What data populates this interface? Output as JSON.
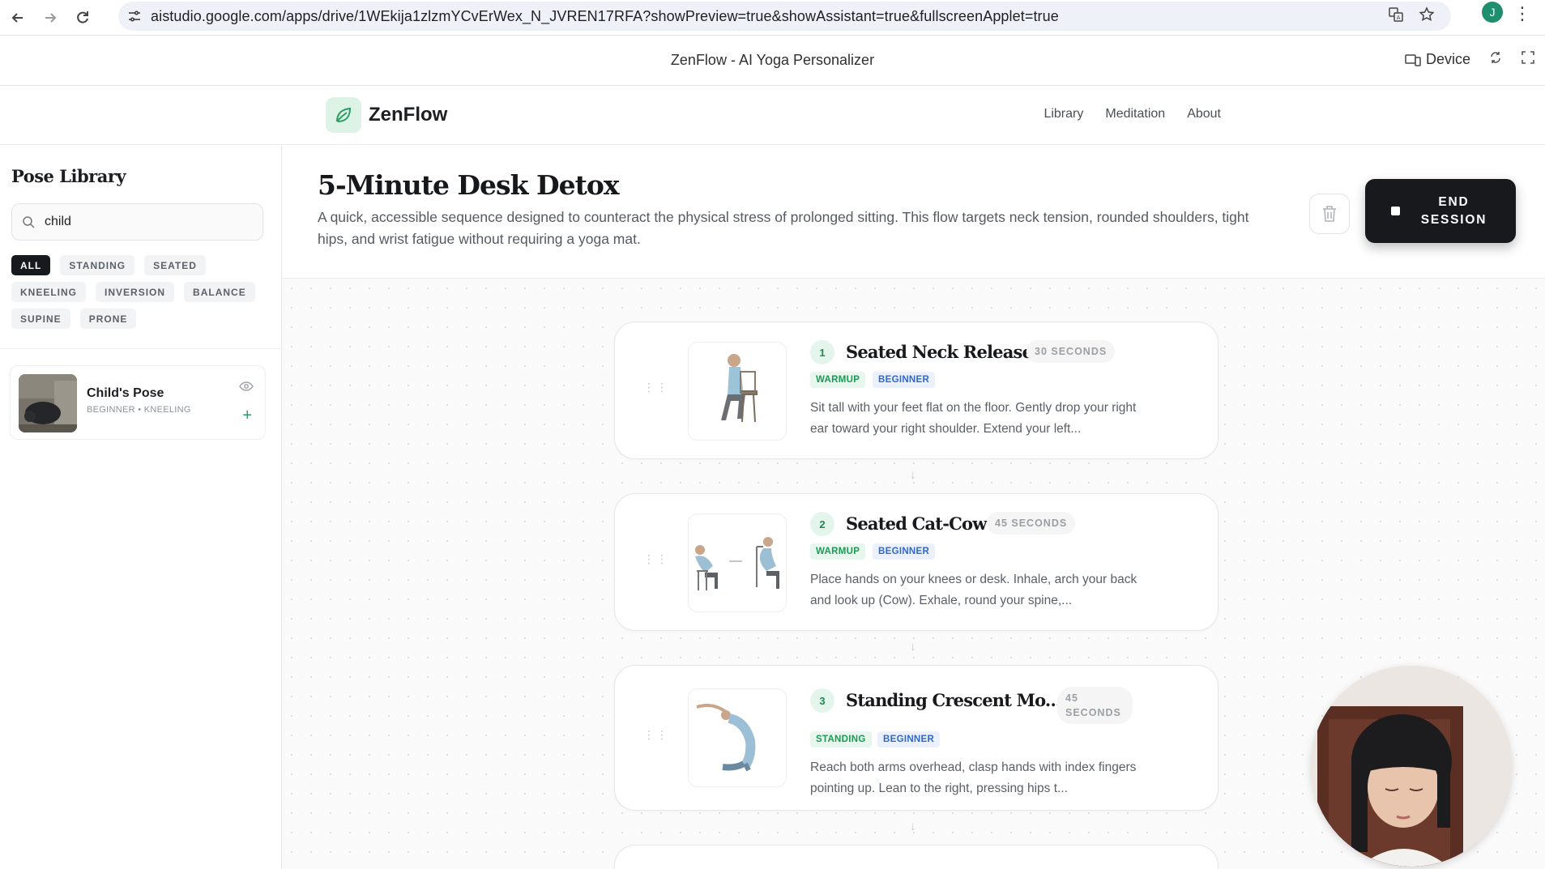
{
  "browser": {
    "url": "aistudio.google.com/apps/drive/1WEkija1zlzmYCvErWex_N_JVREN17RFA?showPreview=true&showAssistant=true&fullscreenApplet=true",
    "avatar_letter": "J"
  },
  "app_bar": {
    "title": "ZenFlow - AI Yoga Personalizer",
    "device_label": "Device"
  },
  "header": {
    "brand": "ZenFlow",
    "nav": [
      "Library",
      "Meditation",
      "About"
    ],
    "accent": "#2a9d63"
  },
  "sidebar": {
    "title": "Pose Library",
    "search_value": "child",
    "filters": [
      "ALL",
      "STANDING",
      "SEATED",
      "KNEELING",
      "INVERSION",
      "BALANCE",
      "SUPINE",
      "PRONE"
    ],
    "active_filter": "ALL",
    "results": [
      {
        "name": "Child's Pose",
        "meta": "BEGINNER • KNEELING"
      }
    ]
  },
  "session": {
    "title": "5-Minute Desk Detox",
    "description": "A quick, accessible sequence designed to counteract the physical stress of prolonged sitting. This flow targets neck tension, rounded shoulders, tight hips, and wrist fatigue without requiring a yoga mat.",
    "end_label": "END SESSION",
    "steps": [
      {
        "number": "1",
        "title": "Seated Neck Releases",
        "duration": "30 SECONDS",
        "tags": [
          "WARMUP",
          "BEGINNER"
        ],
        "description": "Sit tall with your feet flat on the floor. Gently drop your right ear toward your right shoulder. Extend your left..."
      },
      {
        "number": "2",
        "title": "Seated Cat-Cow",
        "duration": "45 SECONDS",
        "tags": [
          "WARMUP",
          "BEGINNER"
        ],
        "description": "Place hands on your knees or desk. Inhale, arch your back and look up (Cow). Exhale, round your spine,..."
      },
      {
        "number": "3",
        "title": "Standing Crescent Mo...",
        "duration_line1": "45",
        "duration_line2": "SECONDS",
        "tags": [
          "STANDING",
          "BEGINNER"
        ],
        "description": "Reach both arms overhead, clasp hands with index fingers pointing up. Lean to the right, pressing hips t..."
      }
    ]
  }
}
